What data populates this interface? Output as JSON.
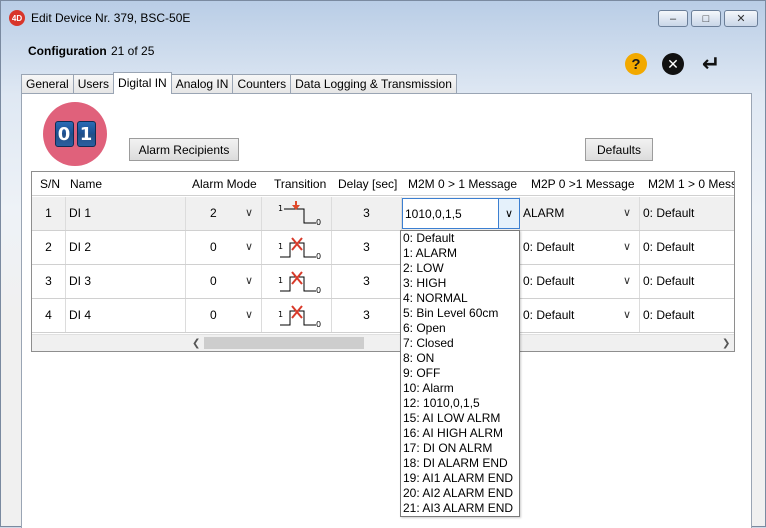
{
  "window": {
    "title": "Edit Device Nr. 379, BSC-50E",
    "app_icon": "4D",
    "controls": {
      "minimize": "minimize-icon",
      "maximize": "maximize-icon",
      "close": "close-icon"
    }
  },
  "header": {
    "config_label": "Configuration",
    "config_count": "21 of 25",
    "icons": [
      "help-icon",
      "cancel-icon",
      "enter-icon"
    ]
  },
  "tabs": [
    {
      "label": "General",
      "active": false
    },
    {
      "label": "Users",
      "active": false
    },
    {
      "label": "Digital IN",
      "active": true
    },
    {
      "label": "Analog IN",
      "active": false
    },
    {
      "label": "Counters",
      "active": false
    },
    {
      "label": "Data Logging & Transmission",
      "active": false
    }
  ],
  "badge": {
    "digits": [
      "0",
      "1"
    ]
  },
  "buttons": {
    "alarm_recipients": "Alarm Recipients",
    "defaults": "Defaults"
  },
  "table": {
    "columns": [
      "S/N",
      "Name",
      "Alarm Mode",
      "Transition",
      "Delay [sec]",
      "M2M 0 > 1 Message",
      "M2P 0 >1 Message",
      "M2M 1 > 0 Mess"
    ],
    "rows": [
      {
        "sn": "1",
        "name": "DI 1",
        "alarm_mode": "2",
        "transition": "enabled",
        "delay": "3",
        "m2m_01": "1010,0,1,5",
        "m2p_01": "ALARM",
        "m2m_10": "0: Default"
      },
      {
        "sn": "2",
        "name": "DI 2",
        "alarm_mode": "0",
        "transition": "disabled",
        "delay": "3",
        "m2m_01": "",
        "m2p_01": "0: Default",
        "m2m_10": "0: Default"
      },
      {
        "sn": "3",
        "name": "DI 3",
        "alarm_mode": "0",
        "transition": "disabled",
        "delay": "3",
        "m2m_01": "",
        "m2p_01": "0: Default",
        "m2m_10": "0: Default"
      },
      {
        "sn": "4",
        "name": "DI 4",
        "alarm_mode": "0",
        "transition": "disabled",
        "delay": "3",
        "m2m_01": "",
        "m2p_01": "0: Default",
        "m2m_10": "0: Default"
      }
    ]
  },
  "dropdown_options": [
    "0: Default",
    "1: ALARM",
    "2: LOW",
    "3: HIGH",
    "4: NORMAL",
    "5: Bin Level 60cm",
    "6: Open",
    "7: Closed",
    "8: ON",
    "9: OFF",
    "10: Alarm",
    "12: 1010,0,1,5",
    "15: AI LOW ALRM",
    "16: AI HIGH ALRM",
    "17: DI ON ALRM",
    "18: DI ALARM END",
    "19: AI1 ALARM END",
    "20: AI2 ALARM END",
    "21: AI3 ALARM END"
  ],
  "colors": {
    "badge": "#e0617b",
    "help": "#f2a900",
    "focus": "#3c7fd1",
    "transition_enabled": "#e0492a",
    "transition_disabled": "#d83a2a"
  }
}
